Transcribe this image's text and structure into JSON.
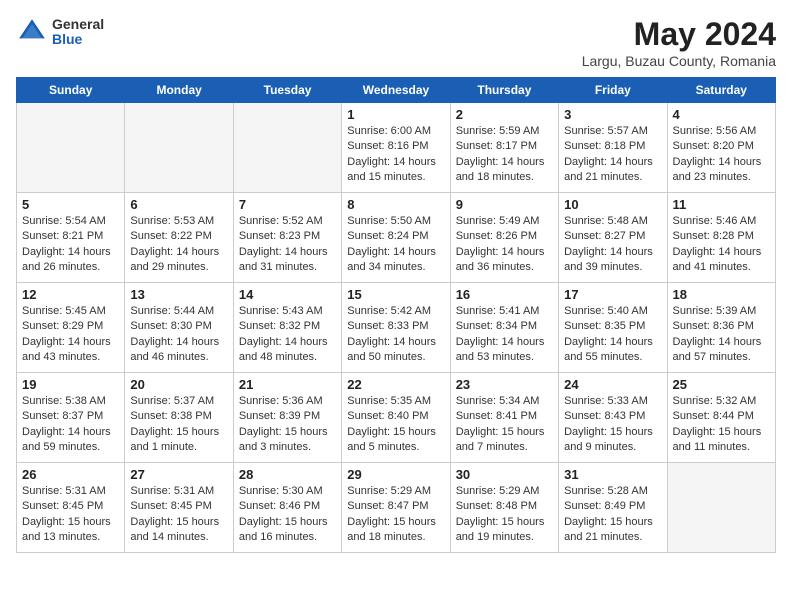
{
  "header": {
    "logo_general": "General",
    "logo_blue": "Blue",
    "title": "May 2024",
    "location": "Largu, Buzau County, Romania"
  },
  "days_of_week": [
    "Sunday",
    "Monday",
    "Tuesday",
    "Wednesday",
    "Thursday",
    "Friday",
    "Saturday"
  ],
  "weeks": [
    [
      {
        "day": "",
        "info": ""
      },
      {
        "day": "",
        "info": ""
      },
      {
        "day": "",
        "info": ""
      },
      {
        "day": "1",
        "info": "Sunrise: 6:00 AM\nSunset: 8:16 PM\nDaylight: 14 hours\nand 15 minutes."
      },
      {
        "day": "2",
        "info": "Sunrise: 5:59 AM\nSunset: 8:17 PM\nDaylight: 14 hours\nand 18 minutes."
      },
      {
        "day": "3",
        "info": "Sunrise: 5:57 AM\nSunset: 8:18 PM\nDaylight: 14 hours\nand 21 minutes."
      },
      {
        "day": "4",
        "info": "Sunrise: 5:56 AM\nSunset: 8:20 PM\nDaylight: 14 hours\nand 23 minutes."
      }
    ],
    [
      {
        "day": "5",
        "info": "Sunrise: 5:54 AM\nSunset: 8:21 PM\nDaylight: 14 hours\nand 26 minutes."
      },
      {
        "day": "6",
        "info": "Sunrise: 5:53 AM\nSunset: 8:22 PM\nDaylight: 14 hours\nand 29 minutes."
      },
      {
        "day": "7",
        "info": "Sunrise: 5:52 AM\nSunset: 8:23 PM\nDaylight: 14 hours\nand 31 minutes."
      },
      {
        "day": "8",
        "info": "Sunrise: 5:50 AM\nSunset: 8:24 PM\nDaylight: 14 hours\nand 34 minutes."
      },
      {
        "day": "9",
        "info": "Sunrise: 5:49 AM\nSunset: 8:26 PM\nDaylight: 14 hours\nand 36 minutes."
      },
      {
        "day": "10",
        "info": "Sunrise: 5:48 AM\nSunset: 8:27 PM\nDaylight: 14 hours\nand 39 minutes."
      },
      {
        "day": "11",
        "info": "Sunrise: 5:46 AM\nSunset: 8:28 PM\nDaylight: 14 hours\nand 41 minutes."
      }
    ],
    [
      {
        "day": "12",
        "info": "Sunrise: 5:45 AM\nSunset: 8:29 PM\nDaylight: 14 hours\nand 43 minutes."
      },
      {
        "day": "13",
        "info": "Sunrise: 5:44 AM\nSunset: 8:30 PM\nDaylight: 14 hours\nand 46 minutes."
      },
      {
        "day": "14",
        "info": "Sunrise: 5:43 AM\nSunset: 8:32 PM\nDaylight: 14 hours\nand 48 minutes."
      },
      {
        "day": "15",
        "info": "Sunrise: 5:42 AM\nSunset: 8:33 PM\nDaylight: 14 hours\nand 50 minutes."
      },
      {
        "day": "16",
        "info": "Sunrise: 5:41 AM\nSunset: 8:34 PM\nDaylight: 14 hours\nand 53 minutes."
      },
      {
        "day": "17",
        "info": "Sunrise: 5:40 AM\nSunset: 8:35 PM\nDaylight: 14 hours\nand 55 minutes."
      },
      {
        "day": "18",
        "info": "Sunrise: 5:39 AM\nSunset: 8:36 PM\nDaylight: 14 hours\nand 57 minutes."
      }
    ],
    [
      {
        "day": "19",
        "info": "Sunrise: 5:38 AM\nSunset: 8:37 PM\nDaylight: 14 hours\nand 59 minutes."
      },
      {
        "day": "20",
        "info": "Sunrise: 5:37 AM\nSunset: 8:38 PM\nDaylight: 15 hours\nand 1 minute."
      },
      {
        "day": "21",
        "info": "Sunrise: 5:36 AM\nSunset: 8:39 PM\nDaylight: 15 hours\nand 3 minutes."
      },
      {
        "day": "22",
        "info": "Sunrise: 5:35 AM\nSunset: 8:40 PM\nDaylight: 15 hours\nand 5 minutes."
      },
      {
        "day": "23",
        "info": "Sunrise: 5:34 AM\nSunset: 8:41 PM\nDaylight: 15 hours\nand 7 minutes."
      },
      {
        "day": "24",
        "info": "Sunrise: 5:33 AM\nSunset: 8:43 PM\nDaylight: 15 hours\nand 9 minutes."
      },
      {
        "day": "25",
        "info": "Sunrise: 5:32 AM\nSunset: 8:44 PM\nDaylight: 15 hours\nand 11 minutes."
      }
    ],
    [
      {
        "day": "26",
        "info": "Sunrise: 5:31 AM\nSunset: 8:45 PM\nDaylight: 15 hours\nand 13 minutes."
      },
      {
        "day": "27",
        "info": "Sunrise: 5:31 AM\nSunset: 8:45 PM\nDaylight: 15 hours\nand 14 minutes."
      },
      {
        "day": "28",
        "info": "Sunrise: 5:30 AM\nSunset: 8:46 PM\nDaylight: 15 hours\nand 16 minutes."
      },
      {
        "day": "29",
        "info": "Sunrise: 5:29 AM\nSunset: 8:47 PM\nDaylight: 15 hours\nand 18 minutes."
      },
      {
        "day": "30",
        "info": "Sunrise: 5:29 AM\nSunset: 8:48 PM\nDaylight: 15 hours\nand 19 minutes."
      },
      {
        "day": "31",
        "info": "Sunrise: 5:28 AM\nSunset: 8:49 PM\nDaylight: 15 hours\nand 21 minutes."
      },
      {
        "day": "",
        "info": ""
      }
    ]
  ]
}
